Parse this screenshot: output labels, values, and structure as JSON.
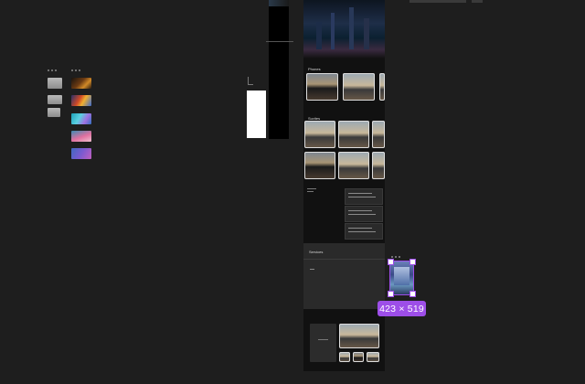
{
  "sections": {
    "phones": "Phones",
    "suvs": "Suvites",
    "services": "Services"
  },
  "selection": {
    "size_label": "423 × 519"
  },
  "colors": {
    "canvas": "#1e1e1e",
    "selection_accent": "#9d4ee8",
    "frame_bg": "#111111"
  }
}
